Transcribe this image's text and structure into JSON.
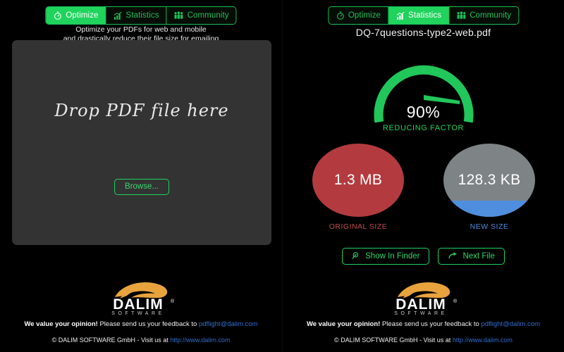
{
  "tabs": [
    {
      "id": "optimize",
      "label": "Optimize",
      "icon": "stopwatch-icon"
    },
    {
      "id": "statistics",
      "label": "Statistics",
      "icon": "bar-chart-icon"
    },
    {
      "id": "community",
      "label": "Community",
      "icon": "people-icon"
    }
  ],
  "left_panel": {
    "active_tab": "Optimize",
    "subtitle_line1": "Optimize your PDFs for web and mobile",
    "subtitle_line2": "and drastically reduce their file size for emailing",
    "dropzone_text": "Drop PDF file here",
    "browse_label": "Browse..."
  },
  "right_panel": {
    "active_tab": "Statistics",
    "filename": "DQ-7questions-type2-web.pdf",
    "gauge": {
      "value_text": "90%",
      "value": 90,
      "label": "REDUCING FACTOR"
    },
    "original": {
      "value_text": "1.3 MB",
      "caption": "ORIGINAL SIZE"
    },
    "new": {
      "value_text": "128.3 KB",
      "caption": "NEW SIZE",
      "fill_percent": 22
    },
    "buttons": [
      {
        "id": "show-in-finder",
        "label": "Show In Finder",
        "icon": "magnifier-icon"
      },
      {
        "id": "next-file",
        "label": "Next File",
        "icon": "arrow-forward-icon"
      }
    ]
  },
  "logo": {
    "wordmark": "DALIM",
    "subtext": "SOFTWARE",
    "registered": "®"
  },
  "footer": {
    "feedback_bold": "We value your opinion!",
    "feedback_text": " Please send us your feedback to ",
    "feedback_email": "pdflight@dalim.com",
    "copyright_text": "© DALIM SOFTWARE GmbH - Visit us at ",
    "copyright_link": "http://www.dalim.com"
  },
  "colors": {
    "accent_green": "#1fd35c",
    "original_red": "#b33b3f",
    "new_gray": "#7e8386",
    "new_blue": "#4f8ede",
    "link_blue": "#2f6fd0",
    "logo_orange": "#e8a33d",
    "dropzone_bg": "#333333"
  }
}
